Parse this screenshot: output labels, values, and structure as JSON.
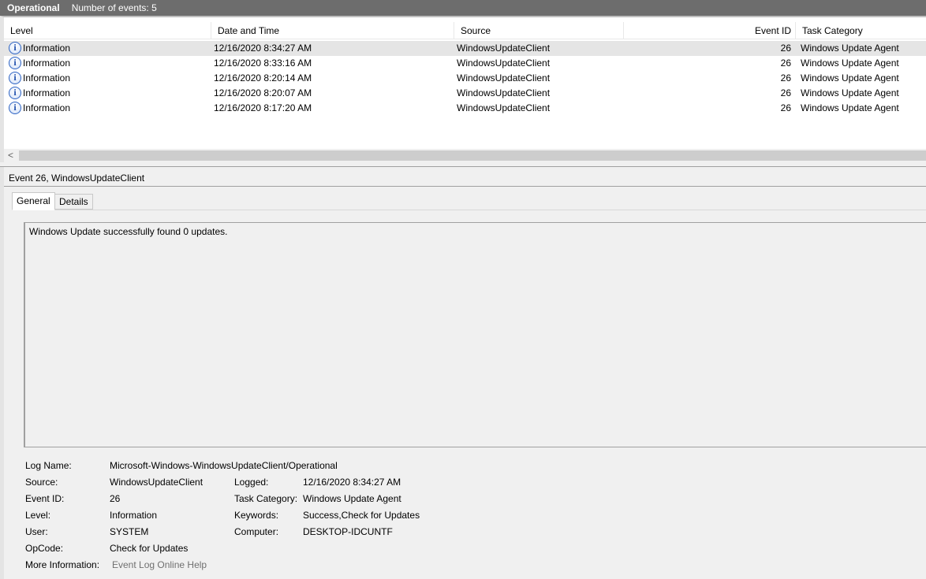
{
  "titlebar": {
    "title": "Operational",
    "count": "Number of events: 5"
  },
  "columns": {
    "level": "Level",
    "datetime": "Date and Time",
    "source": "Source",
    "eventid": "Event ID",
    "category": "Task Category"
  },
  "rows": [
    {
      "level": "Information",
      "datetime": "12/16/2020 8:34:27 AM",
      "source": "WindowsUpdateClient",
      "eventid": "26",
      "category": "Windows Update Agent",
      "selected": true
    },
    {
      "level": "Information",
      "datetime": "12/16/2020 8:33:16 AM",
      "source": "WindowsUpdateClient",
      "eventid": "26",
      "category": "Windows Update Agent"
    },
    {
      "level": "Information",
      "datetime": "12/16/2020 8:20:14 AM",
      "source": "WindowsUpdateClient",
      "eventid": "26",
      "category": "Windows Update Agent"
    },
    {
      "level": "Information",
      "datetime": "12/16/2020 8:20:07 AM",
      "source": "WindowsUpdateClient",
      "eventid": "26",
      "category": "Windows Update Agent"
    },
    {
      "level": "Information",
      "datetime": "12/16/2020 8:17:20 AM",
      "source": "WindowsUpdateClient",
      "eventid": "26",
      "category": "Windows Update Agent"
    }
  ],
  "scroll": {
    "left_arrow": "<"
  },
  "detail": {
    "header": "Event 26, WindowsUpdateClient",
    "tabs": {
      "general": "General",
      "details": "Details"
    },
    "description": "Windows Update successfully found 0 updates.",
    "labels": {
      "log_name": "Log Name:",
      "source": "Source:",
      "event_id": "Event ID:",
      "level": "Level:",
      "user": "User:",
      "opcode": "OpCode:",
      "more_info": "More Information:",
      "logged": "Logged:",
      "task_category": "Task Category:",
      "keywords": "Keywords:",
      "computer": "Computer:"
    },
    "values": {
      "log_name": "Microsoft-Windows-WindowsUpdateClient/Operational",
      "source": "WindowsUpdateClient",
      "event_id": "26",
      "level": "Information",
      "user": "SYSTEM",
      "opcode": "Check for Updates",
      "more_info": "Event Log Online Help",
      "logged": "12/16/2020 8:34:27 AM",
      "task_category": "Windows Update Agent",
      "keywords": "Success,Check for Updates",
      "computer": "DESKTOP-IDCUNTF"
    }
  },
  "colors": {
    "titlebar": "#6d6d6d",
    "selected_row": "#e5e5e5",
    "info_icon": "#2e64c4"
  },
  "icons": {
    "level_info": "information-icon"
  }
}
